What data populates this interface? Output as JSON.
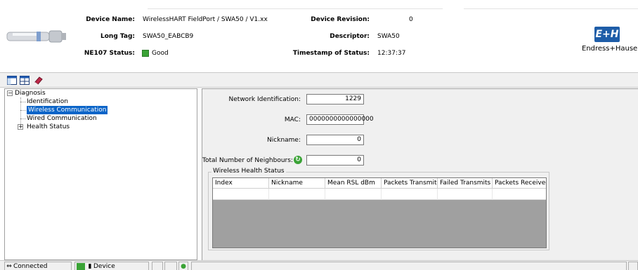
{
  "header": {
    "device_name_label": "Device Name:",
    "device_name_value": "WirelessHART FieldPort / SWA50 / V1.xx",
    "long_tag_label": "Long Tag:",
    "long_tag_value": "SWA50_EABCB9",
    "ne107_label": "NE107 Status:",
    "ne107_value": "Good",
    "ne107_color": "#3aa336",
    "device_revision_label": "Device Revision:",
    "device_revision_value": "0",
    "descriptor_label": "Descriptor:",
    "descriptor_value": "SWA50",
    "timestamp_label": "Timestamp of Status:",
    "timestamp_value": "12:37:37",
    "logo_mark": "E+H",
    "logo_text": "Endress+Hauser",
    "brand_color": "#1e5da8"
  },
  "toolbar": {
    "icons": [
      "window-layout-icon",
      "window-split-icon",
      "book-icon"
    ]
  },
  "tree": {
    "root": "Diagnosis",
    "items": [
      {
        "label": "Identification"
      },
      {
        "label": "Wireless Communication",
        "selected": true
      },
      {
        "label": "Wired Communication"
      },
      {
        "label": "Health Status",
        "expandable": true
      }
    ],
    "selection_color": "#0a64c8"
  },
  "main": {
    "network_id_label": "Network Identification:",
    "network_id_value": "1229",
    "mac_label": "MAC:",
    "mac_value": "0000000000000000",
    "nickname_label": "Nickname:",
    "nickname_value": "0",
    "neighbours_label": "Total Number of Neighbours:",
    "neighbours_value": "0",
    "health_group_title": "Wireless Health Status",
    "columns": [
      "Index",
      "Nickname",
      "Mean RSL dBm",
      "Packets Transmitte",
      "Failed Transmits",
      "Packets Received"
    ]
  },
  "statusbar": {
    "connection": "Connected",
    "device": "Device"
  }
}
